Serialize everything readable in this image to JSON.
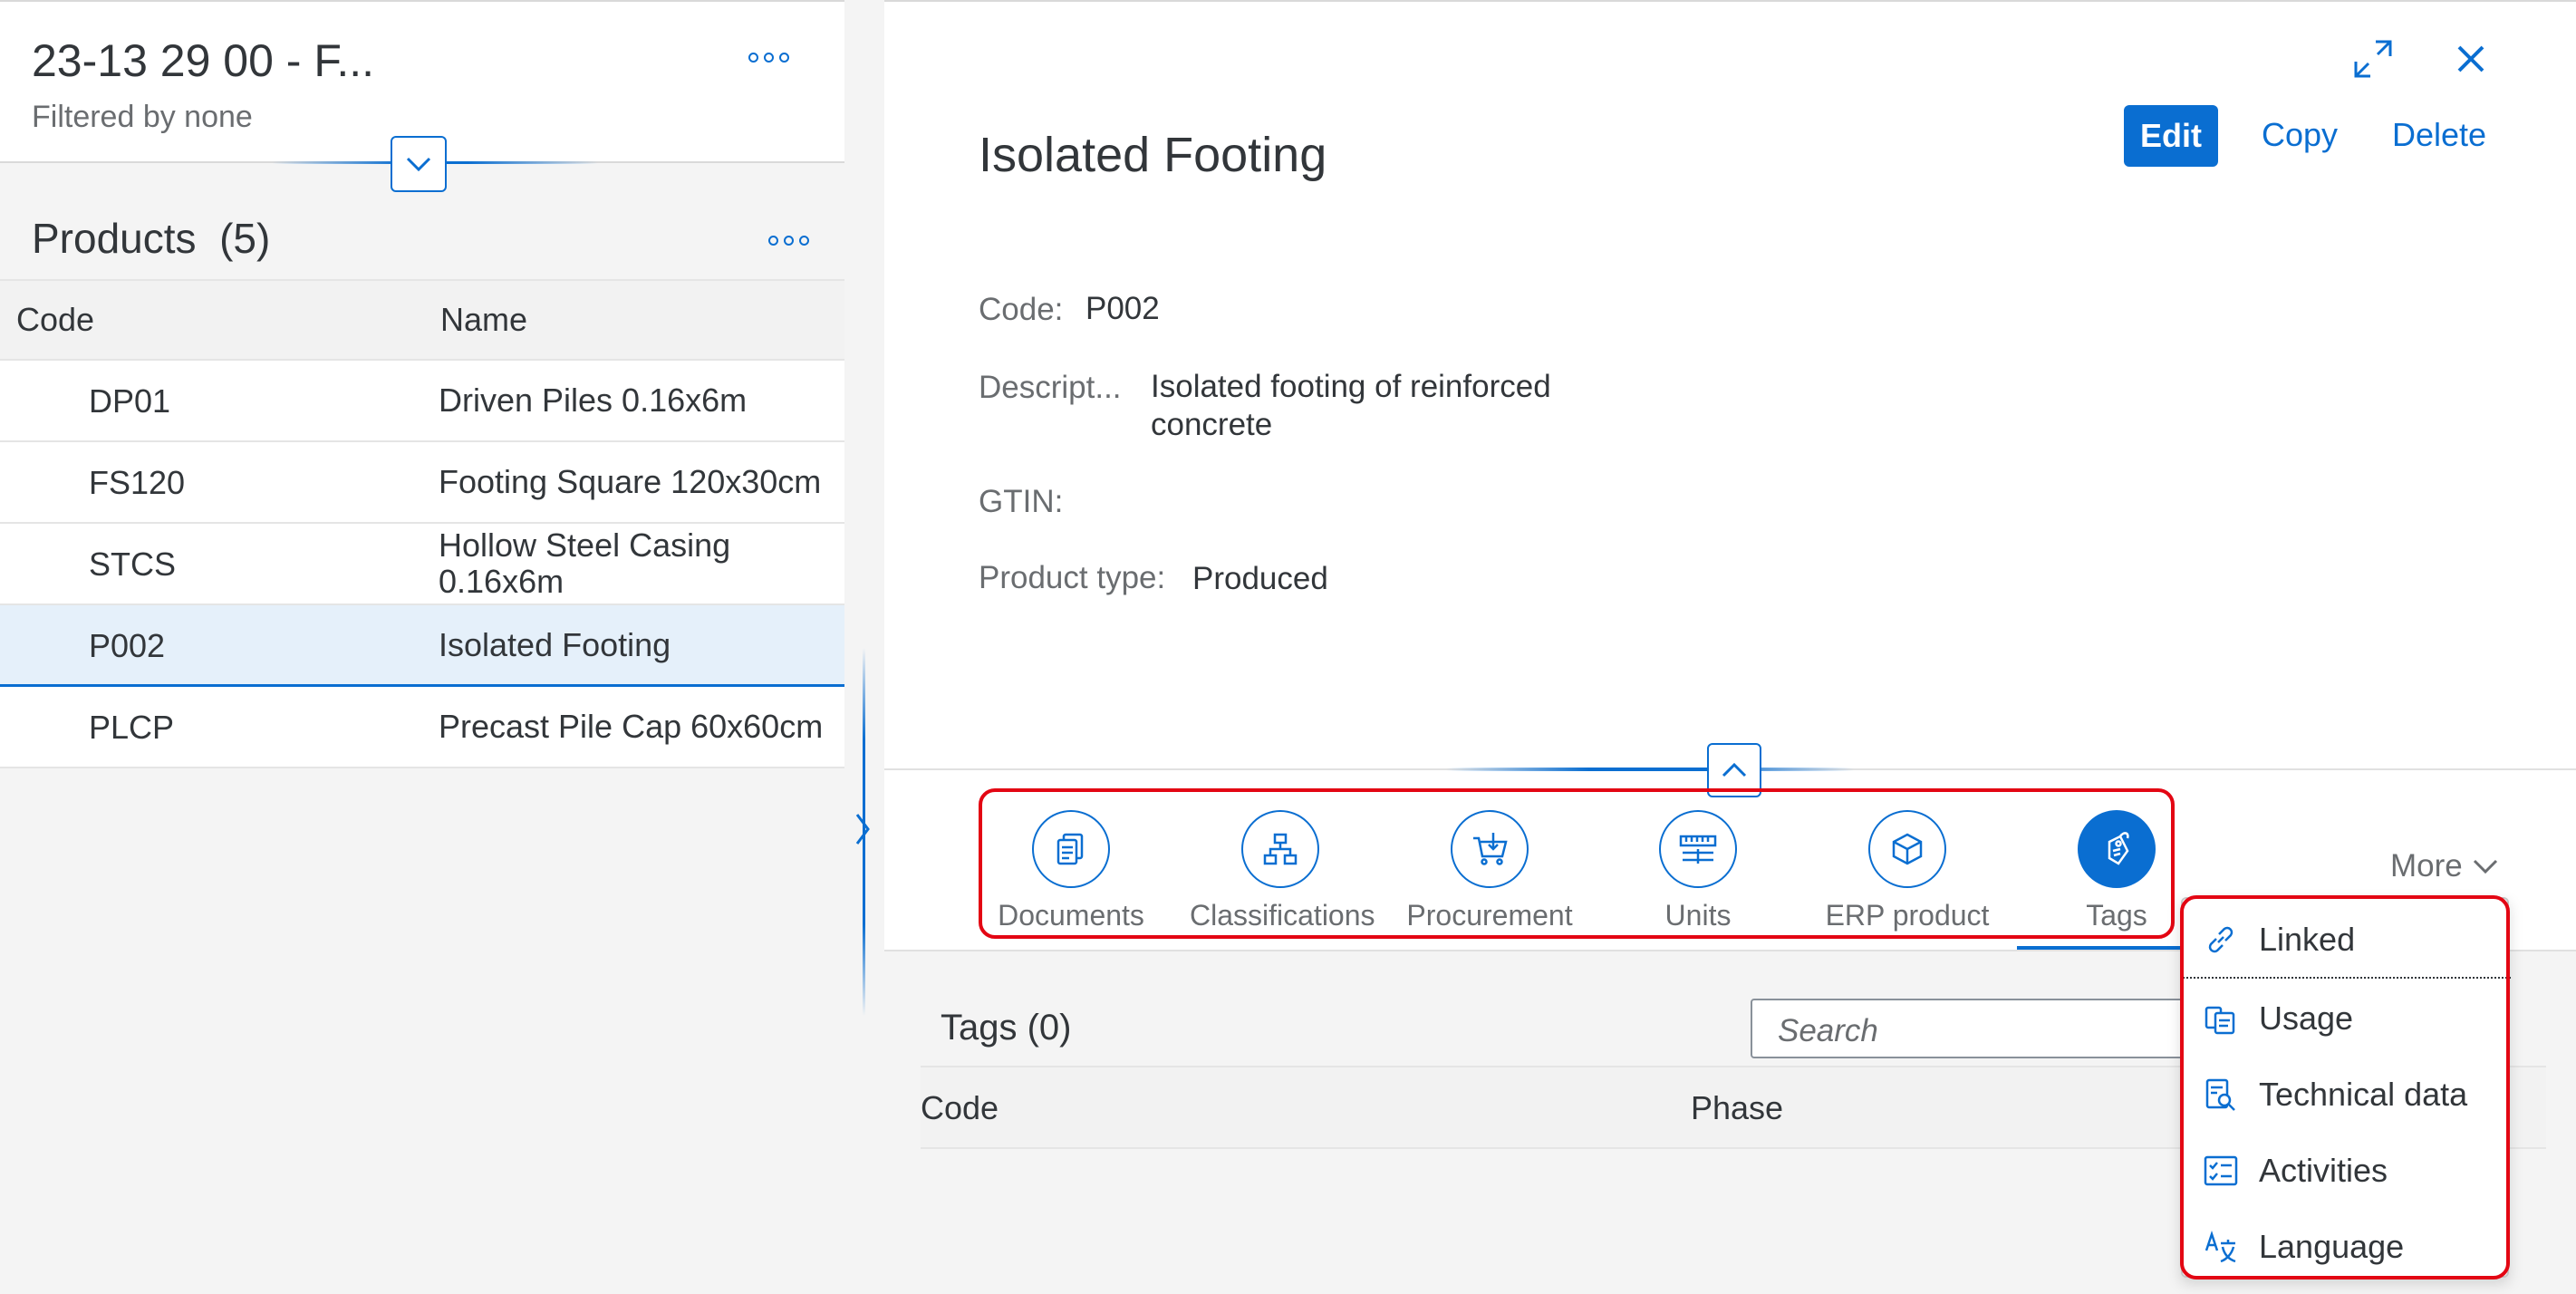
{
  "left": {
    "title": "23-13 29 00 - F...",
    "subtitle": "Filtered by none",
    "products_title": "Products",
    "products_count": "(5)",
    "columns": {
      "code": "Code",
      "name": "Name"
    },
    "rows": [
      {
        "code": "DP01",
        "name": "Driven Piles 0.16x6m"
      },
      {
        "code": "FS120",
        "name": "Footing Square 120x30cm"
      },
      {
        "code": "STCS",
        "name": "Hollow Steel Casing 0.16x6m"
      },
      {
        "code": "P002",
        "name": "Isolated Footing"
      },
      {
        "code": "PLCP",
        "name": "Precast Pile Cap 60x60cm"
      }
    ]
  },
  "detail": {
    "title": "Isolated Footing",
    "actions": {
      "edit": "Edit",
      "copy": "Copy",
      "delete": "Delete"
    },
    "attributes": {
      "code_label": "Code:",
      "code_value": "P002",
      "desc_label": "Descript...",
      "desc_value": "Isolated footing of reinforced concrete",
      "gtin_label": "GTIN:",
      "gtin_value": "",
      "type_label": "Product type:",
      "type_value": "Produced"
    },
    "anchors": [
      {
        "label": "Documents",
        "icon": "documents-icon"
      },
      {
        "label": "Classifications",
        "icon": "hierarchy-icon"
      },
      {
        "label": "Procurement",
        "icon": "cart-icon"
      },
      {
        "label": "Units",
        "icon": "ruler-icon"
      },
      {
        "label": "ERP product",
        "icon": "product-icon"
      },
      {
        "label": "Tags",
        "icon": "tag-icon"
      }
    ],
    "more_label": "More",
    "tags": {
      "title": "Tags (0)",
      "search_placeholder": "Search",
      "columns": {
        "code": "Code",
        "phase": "Phase"
      }
    }
  },
  "menu": {
    "items": [
      {
        "label": "Linked",
        "icon": "link-icon"
      },
      {
        "label": "Usage",
        "icon": "usage-icon"
      },
      {
        "label": "Technical data",
        "icon": "technical-data-icon"
      },
      {
        "label": "Activities",
        "icon": "activities-icon"
      },
      {
        "label": "Language",
        "icon": "language-icon"
      }
    ]
  },
  "colors": {
    "accent": "#0a6ed1",
    "highlight": "#e30613",
    "selected_row": "#e5f0fa"
  }
}
